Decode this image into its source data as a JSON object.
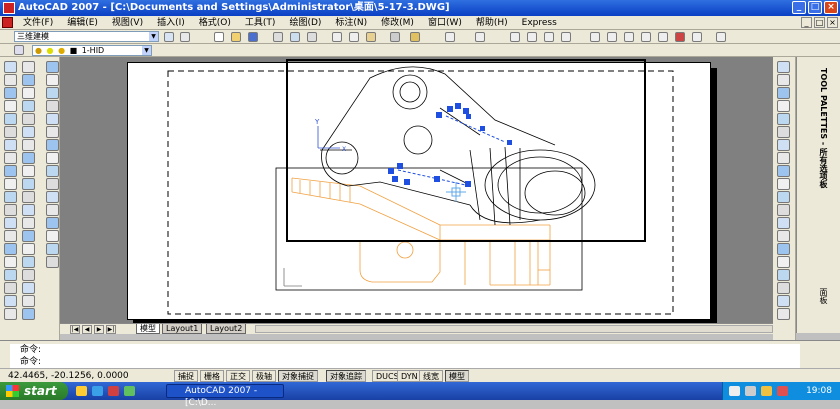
{
  "window": {
    "title": "AutoCAD 2007 - [C:\\Documents and Settings\\Administrator\\桌面\\5-17-3.DWG]",
    "min": "_",
    "max": "□",
    "close": "×"
  },
  "menu": [
    "文件(F)",
    "编辑(E)",
    "视图(V)",
    "插入(I)",
    "格式(O)",
    "工具(T)",
    "绘图(D)",
    "标注(N)",
    "修改(M)",
    "窗口(W)",
    "帮助(H)",
    "Express"
  ],
  "doc_buttons": {
    "min": "_",
    "restore": "□",
    "close": "×"
  },
  "toolbar": {
    "workspace": "三维建模",
    "layer": "1-HID"
  },
  "layout_tabs": [
    "模型",
    "Layout1",
    "Layout2"
  ],
  "tool_palette": {
    "title": "TOOL PALETTES - 所有选项板",
    "face": "面板"
  },
  "command": {
    "line1": "命令:",
    "line2": "命令:"
  },
  "status": {
    "coords": "42.4465,   -20.1256,  0.0000",
    "buttons": [
      "捕捉",
      "栅格",
      "正交",
      "极轴",
      "对象捕捉",
      "对象追踪",
      "DUCS",
      "DYN",
      "线宽",
      "模型"
    ]
  },
  "taskbar": {
    "start": "start",
    "task": "AutoCAD 2007 - [C:\\D...",
    "clock": "19:08"
  },
  "colors": {
    "title": "#0a3fc4",
    "selection": "#1f4fe0",
    "hidden_lines": "#f0a040"
  }
}
